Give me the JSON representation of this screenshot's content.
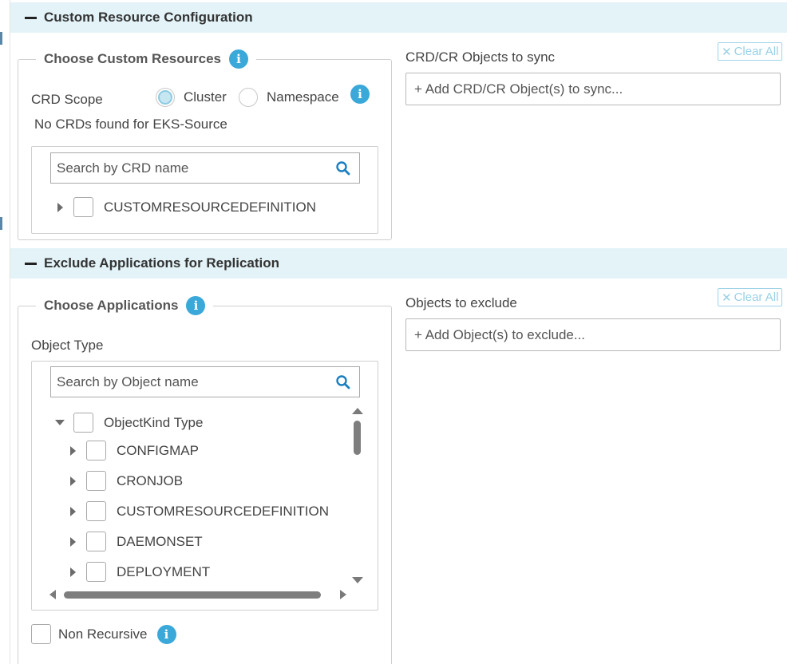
{
  "custom_resources": {
    "header": "Custom Resource Configuration",
    "choose_legend": "Choose Custom Resources",
    "crd_scope_label": "CRD Scope",
    "scope_options": [
      "Cluster",
      "Namespace"
    ],
    "selected_scope": "Cluster",
    "no_crds_message": "No CRDs found for EKS-Source",
    "search_placeholder": "Search by CRD name",
    "tree_items": [
      "CUSTOMRESOURCEDEFINITION"
    ],
    "sync_label": "CRD/CR Objects to sync",
    "sync_placeholder": "+ Add CRD/CR Object(s) to sync...",
    "clear_all": "Clear All"
  },
  "exclude_apps": {
    "header": "Exclude Applications for Replication",
    "choose_legend": "Choose Applications",
    "object_type_label": "Object Type",
    "search_placeholder": "Search by Object name",
    "root_item": "ObjectKind Type",
    "tree_items": [
      "CONFIGMAP",
      "CRONJOB",
      "CUSTOMRESOURCEDEFINITION",
      "DAEMONSET",
      "DEPLOYMENT"
    ],
    "non_recursive_label": "Non Recursive",
    "exclude_label": "Objects to exclude",
    "exclude_placeholder": "+ Add Object(s) to exclude...",
    "clear_all": "Clear All"
  },
  "icons": {
    "info": "info-icon",
    "search": "search-icon",
    "clear": "x-icon",
    "collapse": "minus-icon",
    "expand": "caret-right-icon",
    "expanded": "caret-down-icon"
  },
  "colors": {
    "header_bg": "#e3f3f8",
    "info_blue": "#3aa8d8",
    "clear_all_text": "#9ad0e6",
    "search_icon": "#1a7fc1"
  }
}
